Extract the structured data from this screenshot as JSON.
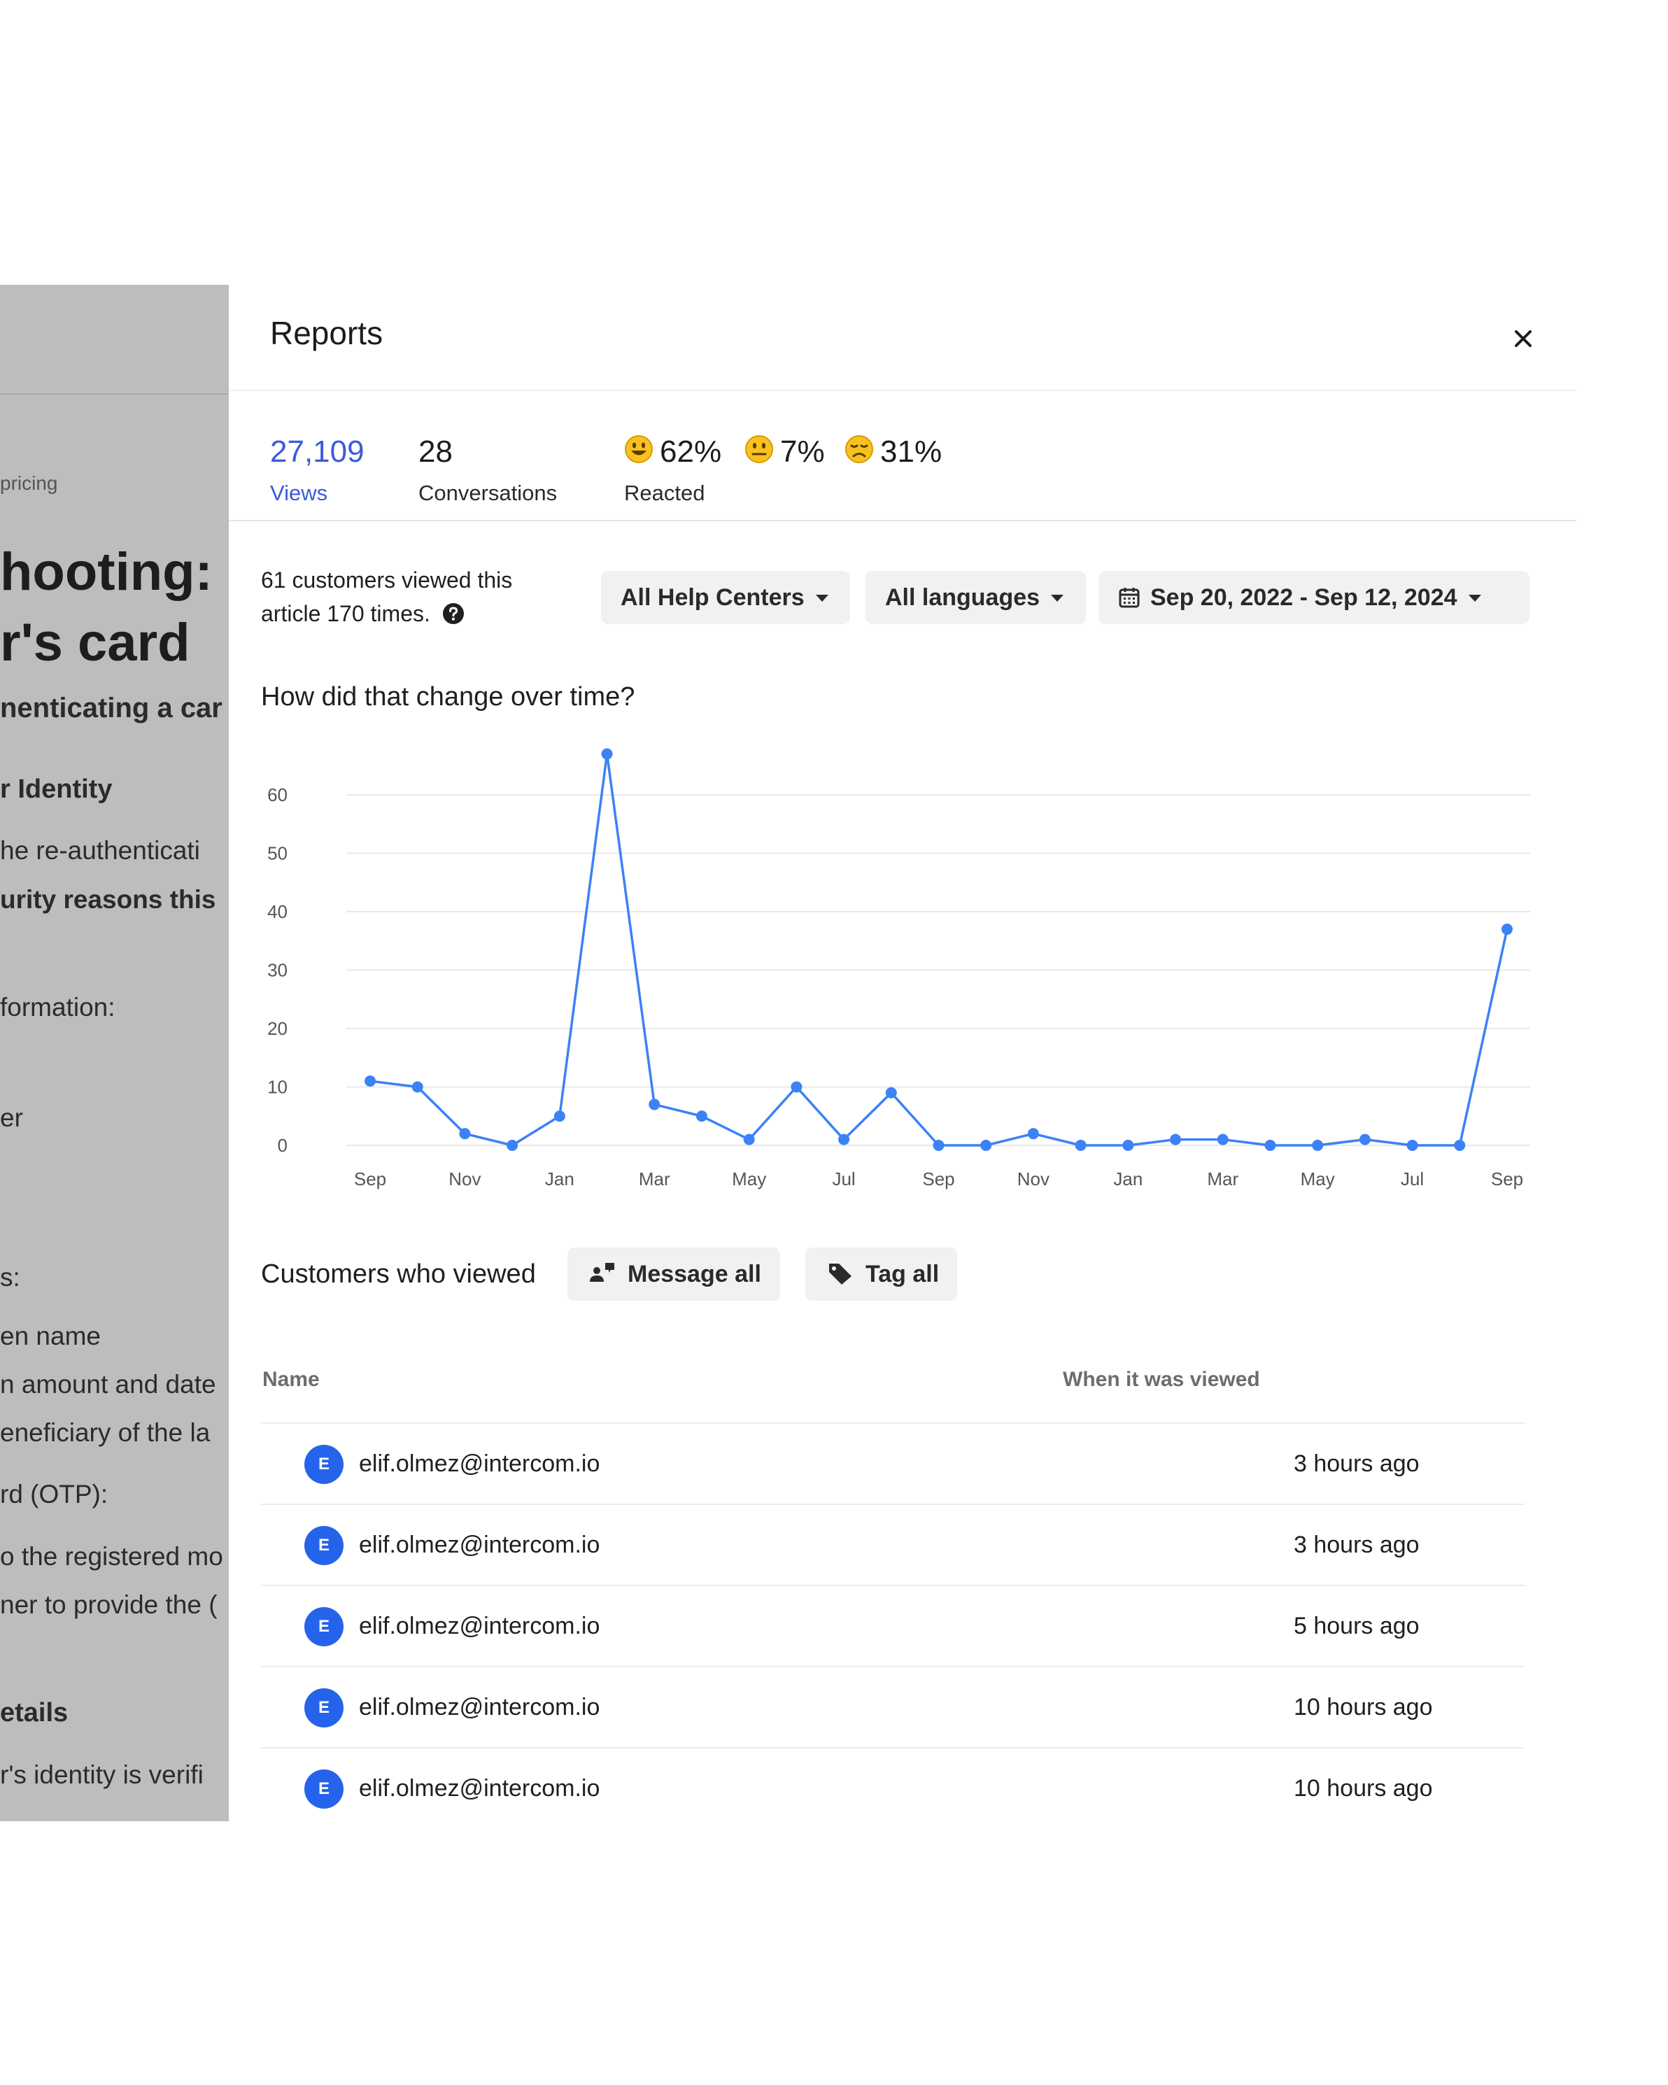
{
  "background_article": {
    "breadcrumb": "pricing",
    "heading_line1": "hooting:",
    "heading_line2": "r's card",
    "subtitle": "nenticating a car",
    "section1": "r Identity",
    "para1": "he re-authenticati",
    "para1_bold": "urity reasons this",
    "info": "formation:",
    "item_er": "er",
    "item_s": "s:",
    "list1": "en name",
    "list2": "n amount and date",
    "list3": "eneficiary of the la",
    "otp": "rd (OTP):",
    "otp1": "o the registered mo",
    "otp2": "ner to provide the (",
    "section2": "etails",
    "para2": "r's identity is verifi"
  },
  "reports": {
    "title": "Reports",
    "stats": {
      "views_value": "27,109",
      "views_label": "Views",
      "conversations_value": "28",
      "conversations_label": "Conversations",
      "reaction_happy": "62%",
      "reaction_neutral": "7%",
      "reaction_sad": "31%",
      "reacted_label": "Reacted"
    },
    "summary_line1": "61 customers viewed this",
    "summary_line2": "article 170 times.",
    "filters": {
      "help_centers": "All Help Centers",
      "languages": "All languages",
      "date_range": "Sep 20, 2022 - Sep 12, 2024"
    },
    "chart_title": "How did that change over time?",
    "customers_title": "Customers who viewed",
    "message_all": "Message all",
    "tag_all": "Tag all",
    "table": {
      "col_name": "Name",
      "col_when": "When it was viewed",
      "rows": [
        {
          "initial": "E",
          "email": "elif.olmez@intercom.io",
          "when": "3 hours ago"
        },
        {
          "initial": "E",
          "email": "elif.olmez@intercom.io",
          "when": "3 hours ago"
        },
        {
          "initial": "E",
          "email": "elif.olmez@intercom.io",
          "when": "5 hours ago"
        },
        {
          "initial": "E",
          "email": "elif.olmez@intercom.io",
          "when": "10 hours ago"
        },
        {
          "initial": "E",
          "email": "elif.olmez@intercom.io",
          "when": "10 hours ago"
        }
      ]
    },
    "colors": {
      "accent": "#3b5bdb",
      "line": "#3b82f6",
      "avatar": "#2563eb"
    }
  },
  "chart_data": {
    "type": "line",
    "title": "How did that change over time?",
    "xlabel": "",
    "ylabel": "",
    "ylim": [
      0,
      60
    ],
    "yticks": [
      0,
      10,
      20,
      30,
      40,
      50,
      60
    ],
    "x_tick_labels": [
      "Sep",
      "Nov",
      "Jan",
      "Mar",
      "May",
      "Jul",
      "Sep",
      "Nov",
      "Jan",
      "Mar",
      "May",
      "Jul",
      "Sep"
    ],
    "x": [
      "Sep 2022",
      "Oct 2022",
      "Nov 2022",
      "Dec 2022",
      "Jan 2023",
      "Feb 2023",
      "Mar 2023",
      "Apr 2023",
      "May 2023",
      "Jun 2023",
      "Jul 2023",
      "Aug 2023",
      "Sep 2023",
      "Oct 2023",
      "Nov 2023",
      "Dec 2023",
      "Jan 2024",
      "Feb 2024",
      "Mar 2024",
      "Apr 2024",
      "May 2024",
      "Jun 2024",
      "Jul 2024",
      "Aug 2024",
      "Sep 2024"
    ],
    "series": [
      {
        "values": [
          11,
          10,
          2,
          0,
          5,
          67,
          7,
          5,
          1,
          10,
          1,
          9,
          0,
          0,
          2,
          0,
          0,
          1,
          1,
          0,
          0,
          1,
          0,
          0,
          37
        ]
      }
    ],
    "grid": true
  }
}
